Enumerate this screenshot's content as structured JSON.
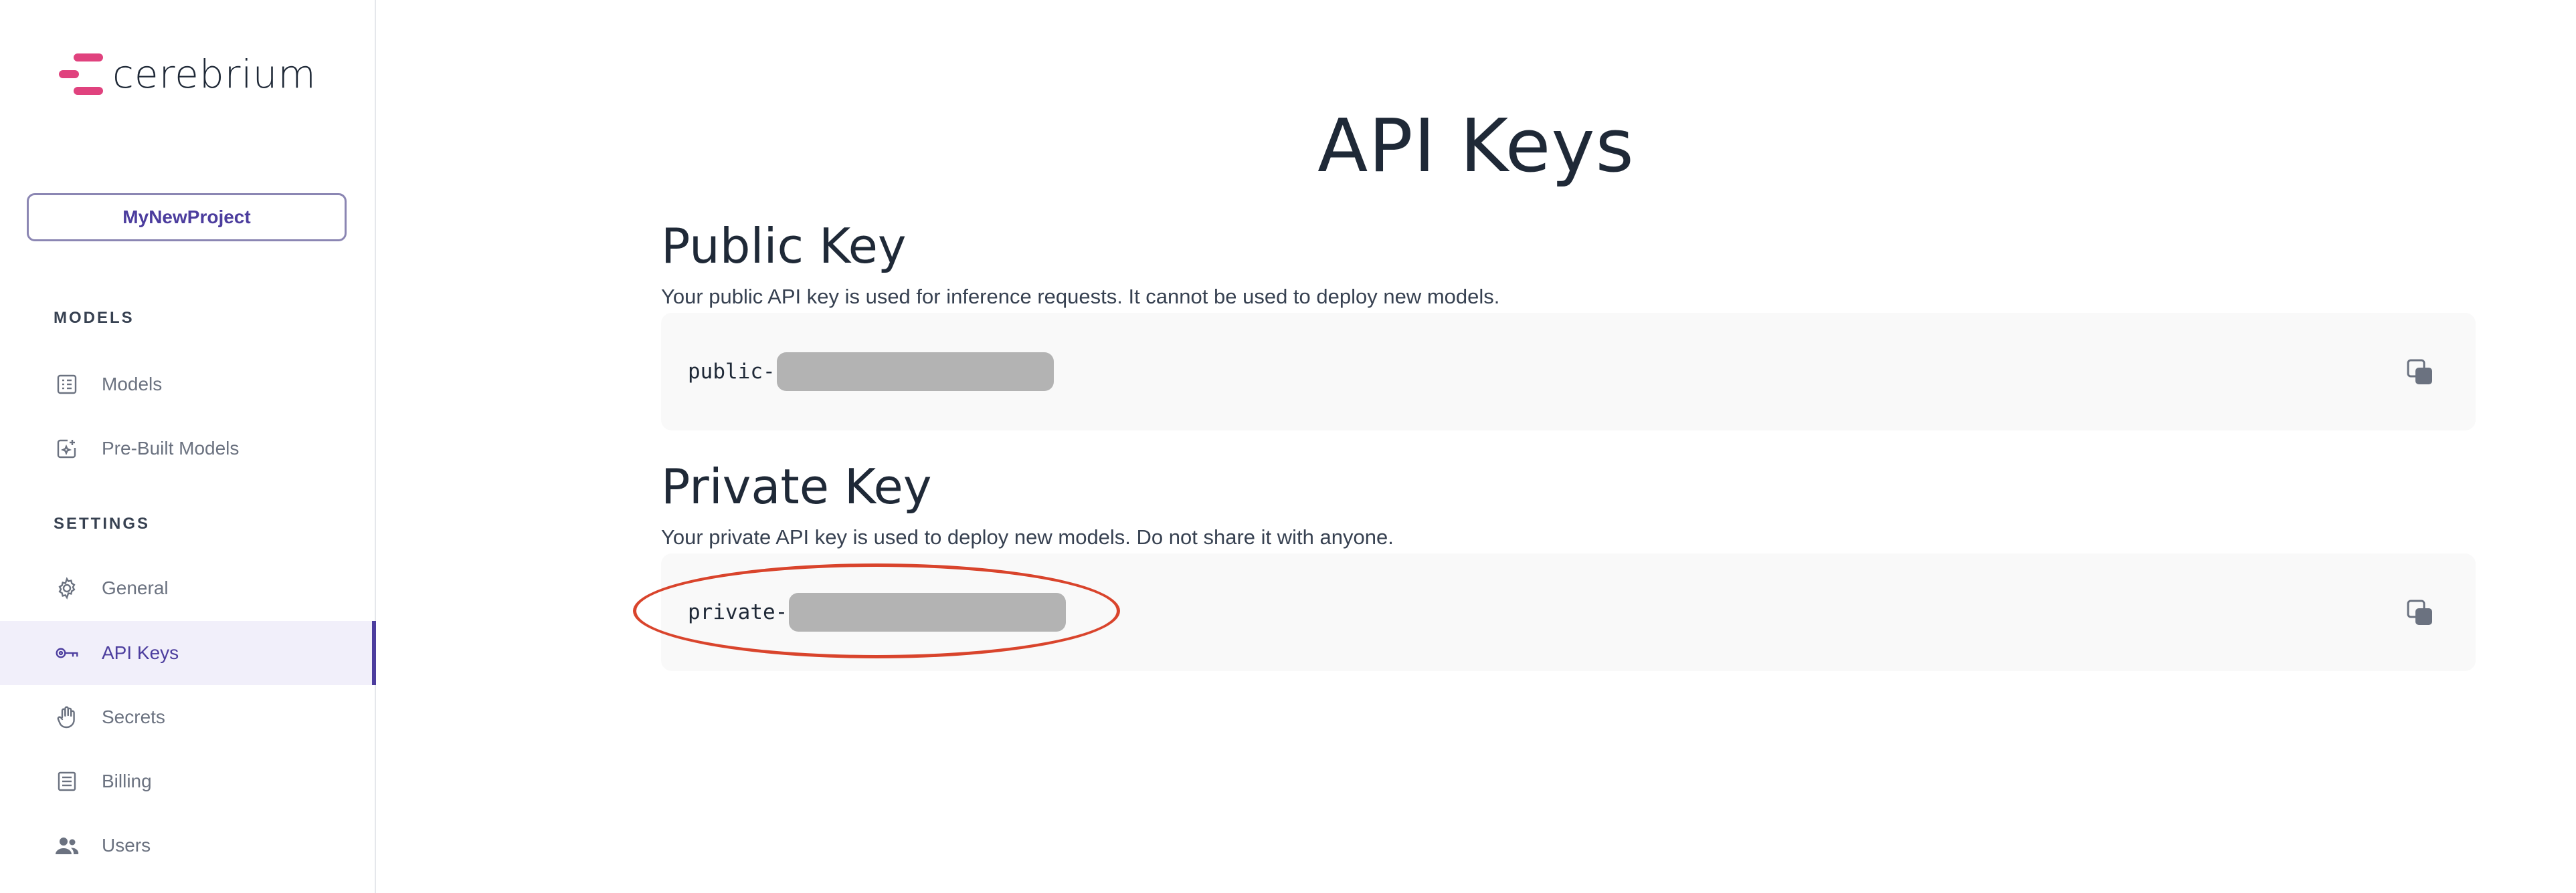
{
  "app": {
    "brand": "cerebrium"
  },
  "sidebar": {
    "project_name": "MyNewProject",
    "sections": [
      {
        "label": "MODELS",
        "items": [
          {
            "label": "Models",
            "icon": "models-icon"
          },
          {
            "label": "Pre-Built Models",
            "icon": "prebuilt-models-icon"
          }
        ]
      },
      {
        "label": "SETTINGS",
        "items": [
          {
            "label": "General",
            "icon": "gear-icon"
          },
          {
            "label": "API Keys",
            "icon": "key-icon",
            "active": true
          },
          {
            "label": "Secrets",
            "icon": "hand-icon"
          },
          {
            "label": "Billing",
            "icon": "billing-icon"
          },
          {
            "label": "Users",
            "icon": "users-icon"
          }
        ]
      }
    ]
  },
  "main": {
    "title": "API Keys",
    "public_key": {
      "title": "Public Key",
      "description": "Your public API key is used for inference requests. It cannot be used to deploy new models.",
      "prefix": "public-"
    },
    "private_key": {
      "title": "Private Key",
      "description": "Your private API key is used to deploy new models. Do not share it with anyone.",
      "prefix": "private-"
    }
  },
  "colors": {
    "accent": "#4c3d9e",
    "brand": "#e0427e",
    "highlight": "#d9442c"
  }
}
